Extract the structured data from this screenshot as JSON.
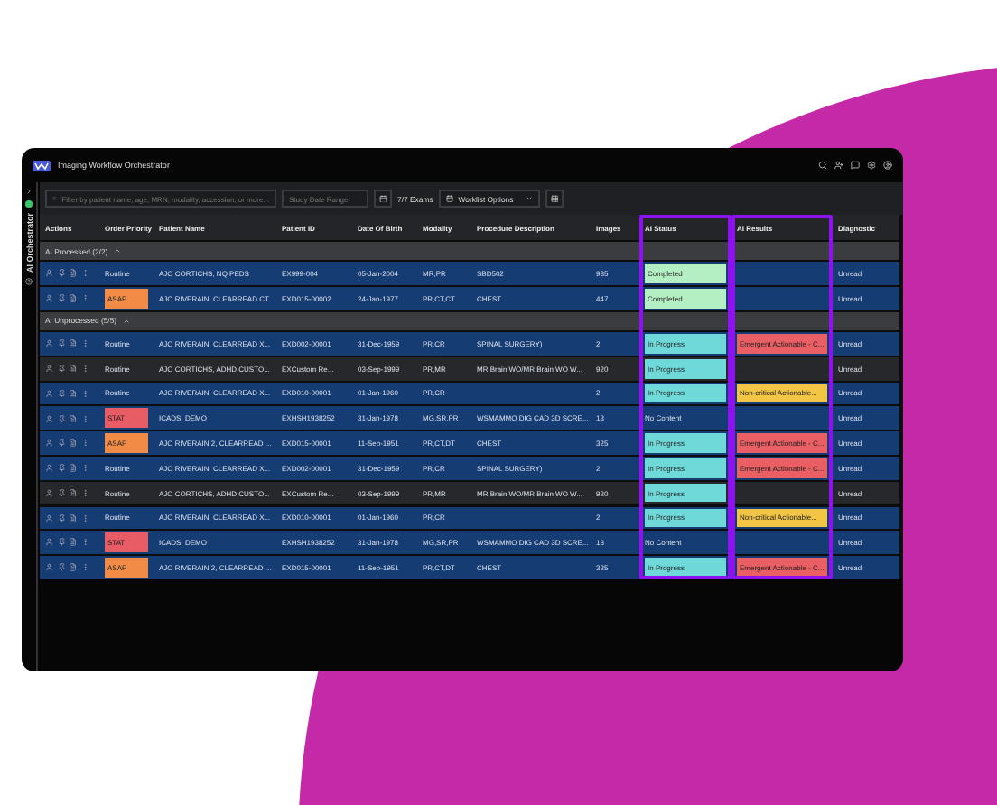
{
  "window": {
    "title": "Imaging Workflow Orchestrator"
  },
  "sidebar": {
    "label": "AI Orchestrator"
  },
  "toolbar": {
    "search": {
      "placeholder": "Filter by patient name, age, MRN, modality, accession, or more..."
    },
    "date_range": {
      "placeholder": "Study Date Range"
    },
    "exam_count": "7/7 Exams",
    "options": "Worklist Options"
  },
  "table": {
    "columns": [
      {
        "label": "Actions",
        "highlighted": false
      },
      {
        "label": "Order Priority",
        "highlighted": false
      },
      {
        "label": "Patient Name",
        "highlighted": false
      },
      {
        "label": "Patient ID",
        "highlighted": false
      },
      {
        "label": "Date Of Birth",
        "highlighted": false
      },
      {
        "label": "Modality",
        "highlighted": false
      },
      {
        "label": "Procedure Description",
        "highlighted": false
      },
      {
        "label": "Images",
        "highlighted": false
      },
      {
        "label": "AI Status",
        "highlighted": true
      },
      {
        "label": "AI Results",
        "highlighted": true
      },
      {
        "label": "Diagnostic",
        "highlighted": false
      }
    ],
    "groups": [
      {
        "title": "AI Processed (2/2)",
        "expanded": true,
        "rows": [
          {
            "color": "#163c74",
            "priority": {
              "text": "Routine"
            },
            "patient_name": "AJO CORTICHS, NQ PEDS",
            "patient_id": "EX999-004",
            "dob": "05-Jan-2004",
            "modality": "MR,PR",
            "procedure": "SBD502",
            "images": "935",
            "status": {
              "text": "Completed",
              "color": "#b3efc2"
            },
            "diagnostic": "Unread"
          },
          {
            "color": "#163c74",
            "priority": {
              "text": "ASAP",
              "color": "#f28b45"
            },
            "patient_name": "AJO RIVERAIN, CLEARREAD CT",
            "patient_id": "EXD015-00002",
            "dob": "24-Jan-1977",
            "modality": "PR,CT,CT",
            "procedure": "CHEST",
            "images": "447",
            "status": {
              "text": "Completed",
              "color": "#b3efc2"
            },
            "diagnostic": "Unread"
          }
        ]
      },
      {
        "title": "AI Unprocessed (5/5)",
        "expanded": true,
        "rows": [
          {
            "color": "#163c74",
            "priority": {
              "text": "Routine"
            },
            "patient_name": "AJO RIVERAIN, CLEARREAD X...",
            "patient_id": "EXD002-00001",
            "dob": "31-Dec-1959",
            "modality": "PR,CR",
            "procedure": "SPINAL SURGERY)",
            "images": "2",
            "status": {
              "text": "In Progress",
              "color": "#6fd9d9"
            },
            "result": {
              "text": "Emergent Actionable - C...",
              "color": "#ea5f63"
            },
            "diagnostic": "Unread"
          },
          {
            "color": "#26282b",
            "priority": {
              "text": "Routine"
            },
            "patient_name": "AJO CORTICHS, ADHD CUSTO...",
            "patient_id": "EXCustom Re...",
            "dob": "03-Sep-1999",
            "modality": "PR,MR",
            "procedure": "MR Brain WO/MR Brain WO W...",
            "images": "920",
            "status": {
              "text": "In Progress",
              "color": "#6fd9d9"
            },
            "diagnostic": "Unread"
          },
          {
            "color": "#163c74",
            "priority": {
              "text": "Routine"
            },
            "patient_name": "AJO RIVERAIN, CLEARREAD X...",
            "patient_id": "EXD010-00001",
            "dob": "01-Jan-1960",
            "modality": "PR,CR",
            "images": "2",
            "status": {
              "text": "In Progress",
              "color": "#6fd9d9"
            },
            "result": {
              "text": "Non-critical Actionable...",
              "color": "#f2c544"
            },
            "diagnostic": "Unread"
          },
          {
            "color": "#163c74",
            "priority": {
              "text": "STAT",
              "color": "#e85c66"
            },
            "patient_name": "ICADS, DEMO",
            "patient_id": "EXHSH1938252",
            "dob": "31-Jan-1978",
            "modality": "MG,SR,PR",
            "procedure": "WSMAMMO DIG CAD 3D SCRE...",
            "images": "13",
            "status": {
              "text": "No Content"
            },
            "diagnostic": "Unread"
          },
          {
            "color": "#163c74",
            "priority": {
              "text": "ASAP",
              "color": "#f28b45"
            },
            "patient_name": "AJO RIVERAIN 2, CLEARREAD ...",
            "patient_id": "EXD015-00001",
            "dob": "11-Sep-1951",
            "modality": "PR,CT,DT",
            "procedure": "CHEST",
            "images": "325",
            "status": {
              "text": "In Progress",
              "color": "#6fd9d9"
            },
            "result": {
              "text": "Emergent Actionable - C...",
              "color": "#ea5f63"
            },
            "diagnostic": "Unread"
          },
          {
            "color": "#163c74",
            "priority": {
              "text": "Routine"
            },
            "patient_name": "AJO RIVERAIN, CLEARREAD X...",
            "patient_id": "EXD002-00001",
            "dob": "31-Dec-1959",
            "modality": "PR,CR",
            "procedure": "SPINAL SURGERY)",
            "images": "2",
            "status": {
              "text": "In Progress",
              "color": "#6fd9d9"
            },
            "result": {
              "text": "Emergent Actionable - C...",
              "color": "#ea5f63"
            },
            "diagnostic": "Unread"
          },
          {
            "color": "#26282b",
            "priority": {
              "text": "Routine"
            },
            "patient_name": "AJO CORTICHS, ADHD CUSTO...",
            "patient_id": "EXCustom Re...",
            "dob": "03-Sep-1999",
            "modality": "PR,MR",
            "procedure": "MR Brain WO/MR Brain WO W...",
            "images": "920",
            "status": {
              "text": "In Progress",
              "color": "#6fd9d9"
            },
            "diagnostic": "Unread"
          },
          {
            "color": "#163c74",
            "priority": {
              "text": "Routine"
            },
            "patient_name": "AJO RIVERAIN, CLEARREAD X...",
            "patient_id": "EXD010-00001",
            "dob": "01-Jan-1960",
            "modality": "PR,CR",
            "images": "2",
            "status": {
              "text": "In Progress",
              "color": "#6fd9d9"
            },
            "result": {
              "text": "Non-critical Actionable...",
              "color": "#f2c544"
            },
            "diagnostic": "Unread"
          },
          {
            "color": "#163c74",
            "priority": {
              "text": "STAT",
              "color": "#e85c66"
            },
            "patient_name": "ICADS, DEMO",
            "patient_id": "EXHSH1938252",
            "dob": "31-Jan-1978",
            "modality": "MG,SR,PR",
            "procedure": "WSMAMMO DIG CAD 3D SCRE...",
            "images": "13",
            "status": {
              "text": "No Content"
            },
            "diagnostic": "Unread"
          },
          {
            "color": "#163c74",
            "priority": {
              "text": "ASAP",
              "color": "#f28b45"
            },
            "patient_name": "AJO RIVERAIN 2, CLEARREAD ...",
            "patient_id": "EXD015-00001",
            "dob": "11-Sep-1951",
            "modality": "PR,CT,DT",
            "procedure": "CHEST",
            "images": "325",
            "status": {
              "text": "In Progress",
              "color": "#6fd9d9"
            },
            "result": {
              "text": "Emergent Actionable - C...",
              "color": "#ea5f63"
            },
            "diagnostic": "Unread"
          }
        ]
      }
    ]
  }
}
